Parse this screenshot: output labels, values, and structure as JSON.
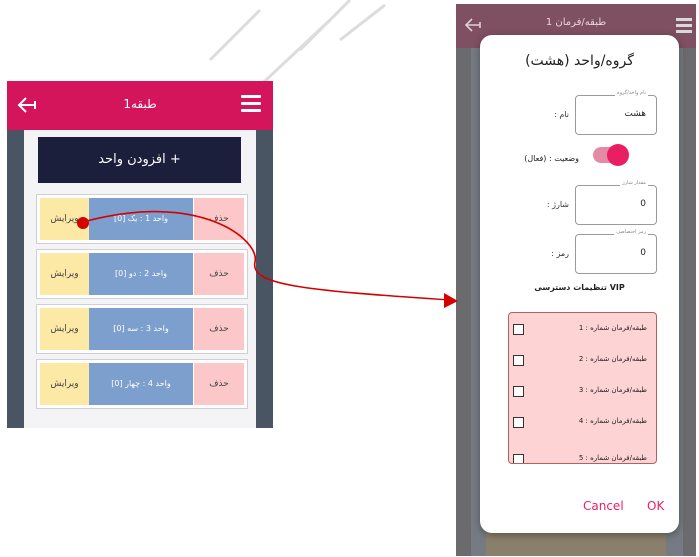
{
  "left": {
    "header_title": "طبقه1",
    "add_label": "افزودن واحد +",
    "units": [
      {
        "delete": "حذف",
        "name": "واحد 1 : یک [0]",
        "edit": "ویرایش"
      },
      {
        "delete": "حذف",
        "name": "واحد 2 : دو [0]",
        "edit": "ویرایش"
      },
      {
        "delete": "حذف",
        "name": "واحد 3 : سه [0]",
        "edit": "ویرایش"
      },
      {
        "delete": "حذف",
        "name": "واحد 4 : چهار [0]",
        "edit": "ویرایش"
      }
    ]
  },
  "right": {
    "header_title": "طبقه/فرمان 1",
    "dialog": {
      "title": "گروه/واحد (هشت)",
      "name_field": {
        "legend": "نام واحد/گروه",
        "value": "هشت",
        "label": ": نام"
      },
      "status_label": "وضعیت : (فعال)",
      "charge_field": {
        "legend": "مقدار شارژ",
        "value": "0",
        "label": ": شارژ"
      },
      "pin_field": {
        "legend": "رمز اختصاصی",
        "value": "0",
        "label": ": رمز"
      },
      "vip_title": "تنظیمات دسترسی VIP",
      "vip_items": [
        "طبقه/فرمان شماره : 1",
        "طبقه/فرمان شماره : 2",
        "طبقه/فرمان شماره : 3",
        "طبقه/فرمان شماره : 4",
        "طبقه/فرمان شماره : 5"
      ],
      "cancel_label": "Cancel",
      "ok_label": "OK"
    }
  },
  "colors": {
    "header": "#d4155c",
    "accent": "#e91e63",
    "arrow": "#d40000"
  }
}
